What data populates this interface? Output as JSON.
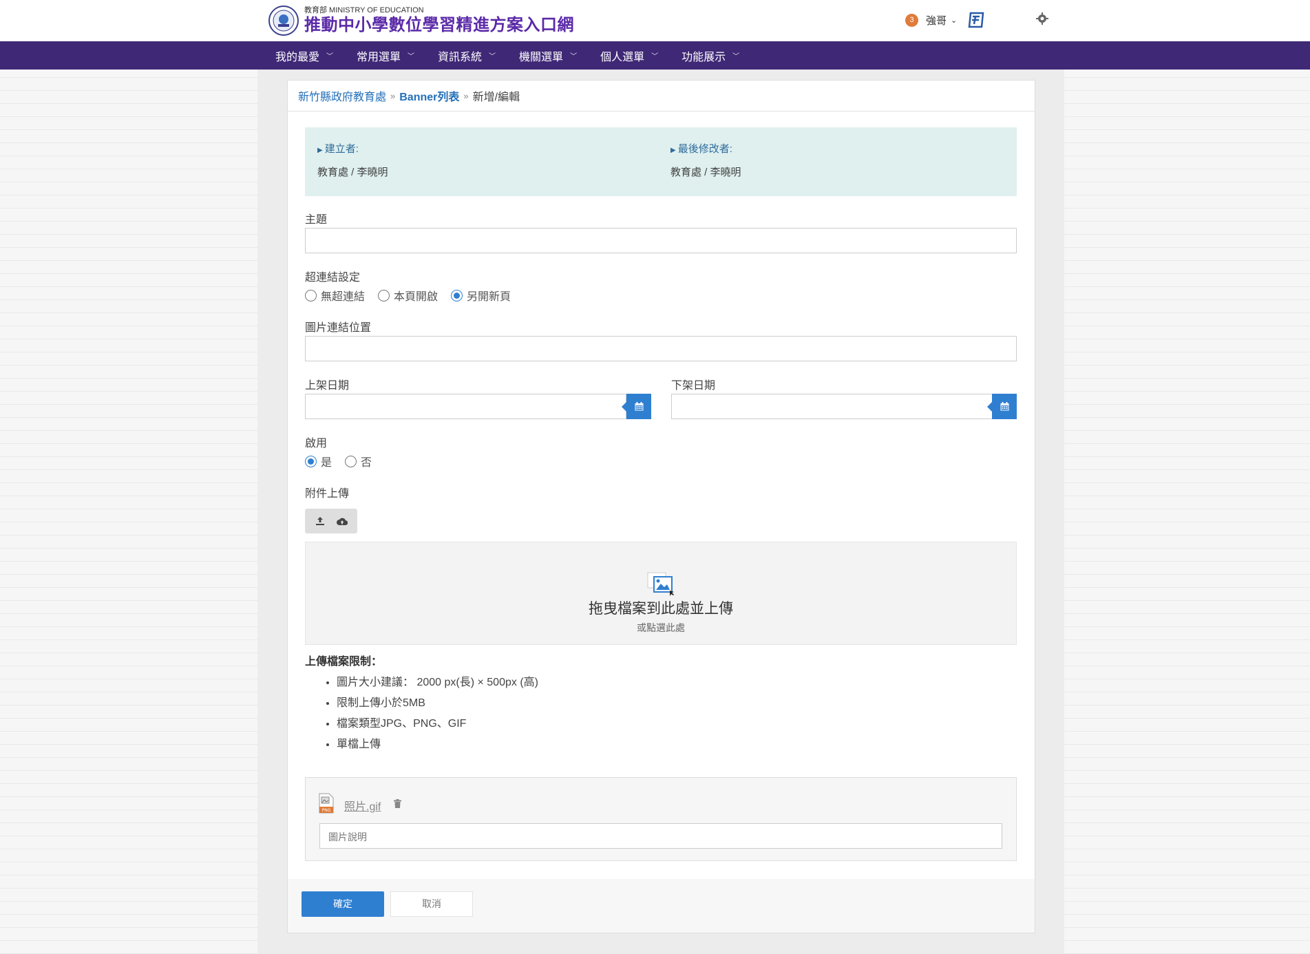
{
  "header": {
    "org_sub": "教育部 MINISTRY OF EDUCATION",
    "site_title": "推動中小學數位學習精進方案入口網",
    "notification_count": "3",
    "user_name": "強哥"
  },
  "nav": {
    "items": [
      {
        "label": "我的最愛"
      },
      {
        "label": "常用選單"
      },
      {
        "label": "資訊系統"
      },
      {
        "label": "機關選單"
      },
      {
        "label": "個人選單"
      },
      {
        "label": "功能展示"
      }
    ]
  },
  "breadcrumb": {
    "org": "新竹縣政府教育處",
    "list": "Banner列表",
    "current": "新增/編輯"
  },
  "info": {
    "creator_label": "建立者:",
    "creator_value": "教育處 / 李曉明",
    "modifier_label": "最後修改者:",
    "modifier_value": "教育處 / 李曉明"
  },
  "form": {
    "subject_label": "主題",
    "subject_value": "",
    "link_label": "超連結設定",
    "link_options": [
      "無超連結",
      "本頁開啟",
      "另開新頁"
    ],
    "link_selected": "另開新頁",
    "image_link_label": "圖片連結位置",
    "image_link_value": "",
    "start_date_label": "上架日期",
    "start_date_value": "",
    "end_date_label": "下架日期",
    "end_date_value": "",
    "enable_label": "啟用",
    "enable_options": [
      "是",
      "否"
    ],
    "enable_selected": "是",
    "attachment_label": "附件上傳"
  },
  "dropzone": {
    "title": "拖曳檔案到此處並上傳",
    "subtitle": "或點選此處"
  },
  "limits": {
    "title": "上傳檔案限制：",
    "items": [
      "圖片大小建議： 2000 px(長) × 500px (高)",
      "限制上傳小於5MB",
      "檔案類型JPG、PNG、GIF",
      "單檔上傳"
    ]
  },
  "file": {
    "name": "照片.gif",
    "type_badge": "PNG",
    "description_placeholder": "圖片說明"
  },
  "actions": {
    "confirm": "確定",
    "cancel": "取消"
  },
  "colors": {
    "brand_purple": "#5b2aa8",
    "nav_bg": "#3f2876",
    "accent_blue": "#2f7fd1",
    "info_bg": "#dff0ef"
  }
}
